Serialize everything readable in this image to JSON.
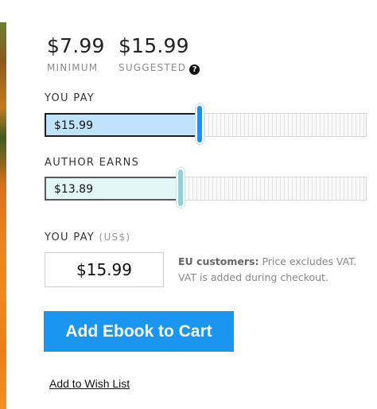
{
  "pricing": {
    "minimum": {
      "value": "$7.99",
      "caption": "MINIMUM"
    },
    "suggested": {
      "value": "$15.99",
      "caption": "SUGGESTED",
      "help_icon": "question-circle-icon"
    }
  },
  "you_pay_slider": {
    "label": "YOU PAY",
    "value": "$15.99",
    "level_fraction": 0.48
  },
  "author_earns_slider": {
    "label": "AUTHOR EARNS",
    "value": "$13.89",
    "level_fraction": 0.42
  },
  "amount": {
    "label": "YOU PAY",
    "currency": "(US$)",
    "value": "$15.99"
  },
  "vat_note": {
    "bold": "EU customers:",
    "text": " Price excludes VAT. VAT is added during checkout."
  },
  "actions": {
    "add_to_cart": "Add Ebook to Cart",
    "wish_list": "Add to Wish List"
  },
  "colors": {
    "primary_button": "#1a96f0",
    "you_pay_fill": "#bfe3fb",
    "you_pay_handle": "#1e90e8",
    "author_fill": "#e4f7f7",
    "author_handle": "#8fd3d8"
  }
}
